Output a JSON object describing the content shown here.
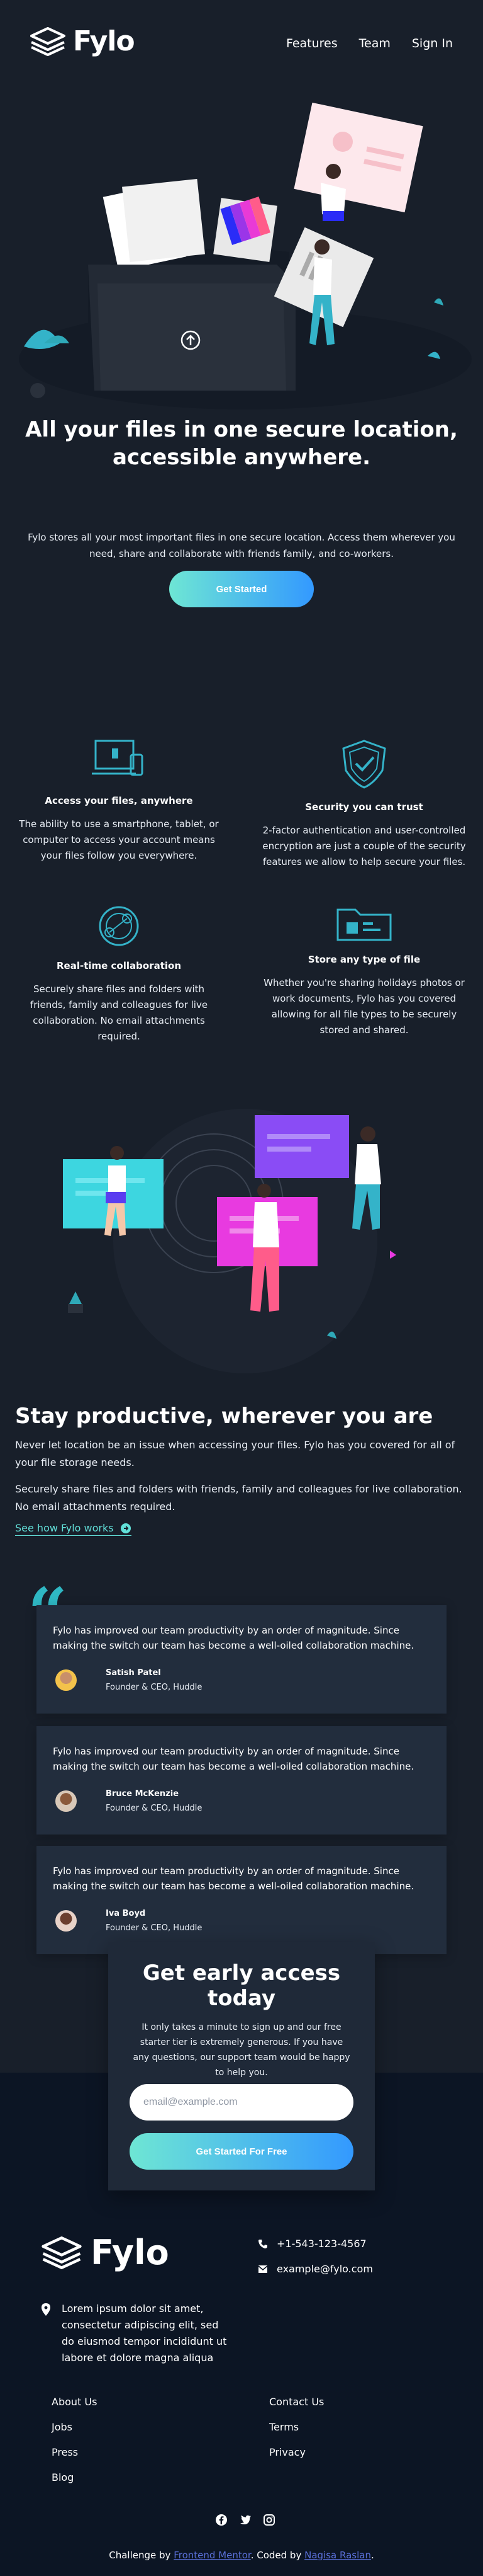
{
  "header": {
    "logo_text": "Fylo",
    "nav": [
      "Features",
      "Team",
      "Sign In"
    ]
  },
  "hero": {
    "title_line1": "All your files in one secure location,",
    "title_line2": "accessible anywhere.",
    "text": "Fylo stores all your most important files in one secure location. Access them wherever you need, share and collaborate with friends family, and co-workers.",
    "cta": "Get Started"
  },
  "features": [
    {
      "title": "Access your files, anywhere",
      "text": "The ability to use a smartphone, tablet, or computer to access your account means your files follow you everywhere."
    },
    {
      "title": "Security you can trust",
      "text": "2-factor authentication and user-controlled encryption are just a couple of the security features we allow to help secure your files."
    },
    {
      "title": "Real-time collaboration",
      "text": "Securely share files and folders with friends, family and colleagues for live collaboration. No email attachments required."
    },
    {
      "title": "Store any type of file",
      "text": "Whether you're sharing holidays photos or work documents, Fylo has you covered allowing for all file types to be securely stored and shared."
    }
  ],
  "productive": {
    "title": "Stay productive, wherever you are",
    "p1": "Never let location be an issue when accessing your files. Fylo has you covered for all of your file storage needs.",
    "p2": "Securely share files and folders with friends, family and colleagues for live collaboration. No email attachments required.",
    "link": "See how Fylo works"
  },
  "testimonials": [
    {
      "quote": "Fylo has improved our team productivity by an order of magnitude. Since making the switch our team has become a well-oiled collaboration machine.",
      "name": "Satish Patel",
      "role": "Founder & CEO, Huddle"
    },
    {
      "quote": "Fylo has improved our team productivity by an order of magnitude. Since making the switch our team has become a well-oiled collaboration machine.",
      "name": "Bruce McKenzie",
      "role": "Founder & CEO, Huddle"
    },
    {
      "quote": "Fylo has improved our team productivity by an order of magnitude. Since making the switch our team has become a well-oiled collaboration machine.",
      "name": "Iva Boyd",
      "role": "Founder & CEO, Huddle"
    }
  ],
  "access": {
    "title": "Get early access today",
    "text": "It only takes a minute to sign up and our free starter tier is extremely generous. If you have any questions, our support team would be happy to help you.",
    "email_placeholder": "email@example.com",
    "button": "Get Started For Free"
  },
  "footer": {
    "logo_text": "Fylo",
    "phone": "+1-543-123-4567",
    "email": "example@fylo.com",
    "address": "Lorem ipsum dolor sit amet, consectetur adipiscing elit, sed do eiusmod tempor incididunt ut labore et dolore magna aliqua",
    "links_col1": [
      "About Us",
      "Jobs",
      "Press",
      "Blog"
    ],
    "links_col2": [
      "Contact Us",
      "Terms",
      "Privacy"
    ],
    "credit_prefix": "Challenge by",
    "credit_link1": "Frontend Mentor",
    "credit_middle": ". Coded by",
    "credit_link2": "Nagisa Raslan",
    "credit_suffix": "."
  },
  "colors": {
    "background": "#181f2a",
    "footer_bg": "#0c1524",
    "card_bg": "#222d3d",
    "accent_cyan": "#62e0d9",
    "gradient_start": "#6ee6d4",
    "gradient_end": "#3399ff"
  },
  "icons": [
    "logo-icon",
    "upload-icon",
    "arrow-circle-right-icon",
    "location-pin-icon",
    "phone-icon",
    "email-icon",
    "facebook-icon",
    "twitter-icon",
    "instagram-icon",
    "quote-icon"
  ]
}
